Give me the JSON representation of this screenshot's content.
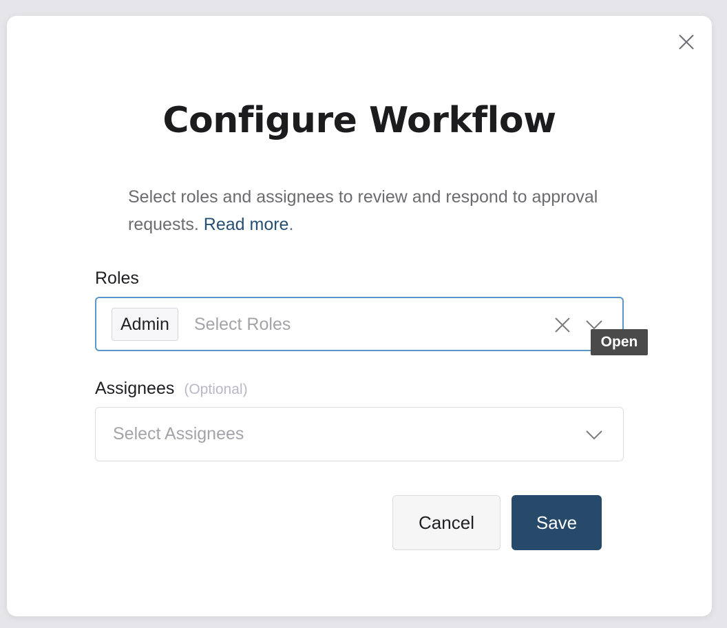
{
  "modal": {
    "title": "Configure Workflow",
    "description_text": "Select roles and assignees to review and respond to approval requests.",
    "description_link": "Read more",
    "description_end": "."
  },
  "roles": {
    "label": "Roles",
    "selected": [
      "Admin"
    ],
    "placeholder": "Select Roles"
  },
  "assignees": {
    "label": "Assignees",
    "optional_label": "(Optional)",
    "placeholder": "Select Assignees"
  },
  "tooltip": {
    "text": "Open"
  },
  "actions": {
    "cancel_label": "Cancel",
    "save_label": "Save"
  },
  "icons": {
    "close": "close-icon",
    "clear": "clear-icon",
    "chevron": "chevron-down-icon"
  },
  "colors": {
    "primary": "#274a6b",
    "link": "#254f73",
    "focus_border": "#5b95c7"
  }
}
